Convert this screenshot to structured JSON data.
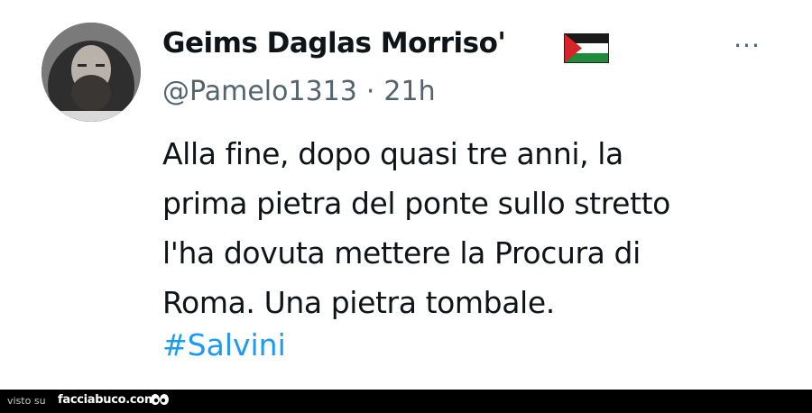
{
  "tweet": {
    "display_name": "Geims Daglas Morriso'",
    "handle": "@Pamelo1313",
    "separator": "·",
    "time": "21h",
    "more_label": "···",
    "text_lines": [
      "Alla fine, dopo quasi tre anni, la",
      "prima pietra del ponte sullo stretto",
      "l'ha dovuta mettere la Procura di",
      "Roma. Una pietra tombale."
    ],
    "hashtag": "#Salvini",
    "flag_icon": "palestine-flag-icon",
    "colors": {
      "text": "#0f1419",
      "secondary": "#536471",
      "link": "#1d9bf0"
    }
  },
  "watermark": {
    "prefix": "visto su",
    "site": "facciabuco.com",
    "logo_icon": "facciabuco-eyes-icon"
  }
}
